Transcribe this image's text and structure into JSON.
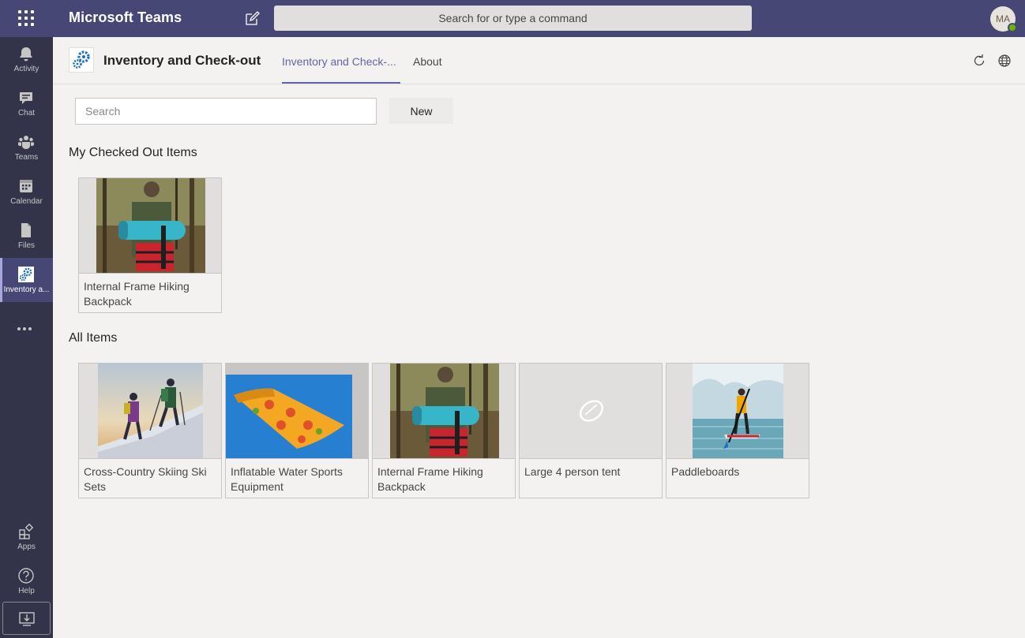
{
  "titlebar": {
    "app_name": "Microsoft Teams",
    "search_placeholder": "Search for or type a command",
    "avatar_initials": "MA"
  },
  "rail": {
    "items": [
      {
        "label": "Activity",
        "icon": "bell-icon"
      },
      {
        "label": "Chat",
        "icon": "chat-icon"
      },
      {
        "label": "Teams",
        "icon": "teams-icon"
      },
      {
        "label": "Calendar",
        "icon": "calendar-icon"
      },
      {
        "label": "Files",
        "icon": "file-icon"
      },
      {
        "label": "Inventory a...",
        "icon": "gear-icon",
        "active": true
      }
    ],
    "bottom_items": [
      {
        "label": "Apps",
        "icon": "apps-icon"
      },
      {
        "label": "Help",
        "icon": "help-icon"
      }
    ]
  },
  "app": {
    "title": "Inventory and Check-out",
    "tabs": [
      {
        "label": "Inventory and Check-...",
        "active": true
      },
      {
        "label": "About",
        "active": false
      }
    ]
  },
  "toolbar": {
    "search_placeholder": "Search",
    "new_label": "New"
  },
  "sections": {
    "checked_out": {
      "title": "My Checked Out Items",
      "items": [
        {
          "label": "Internal Frame Hiking Backpack",
          "image": "backpack-photo"
        }
      ]
    },
    "all_items": {
      "title": "All Items",
      "items": [
        {
          "label": "Cross-Country Skiing Ski Sets",
          "image": "hikers-photo"
        },
        {
          "label": "Inflatable Water Sports Equipment",
          "image": "pizza-float-photo"
        },
        {
          "label": "Internal Frame Hiking Backpack",
          "image": "backpack-photo"
        },
        {
          "label": "Large 4 person tent",
          "image": "placeholder-icon"
        },
        {
          "label": "Paddleboards",
          "image": "paddleboard-photo"
        }
      ]
    }
  },
  "colors": {
    "titlebar": "#464775",
    "rail": "#33344a",
    "accent": "#6264a7",
    "background": "#f3f2f1",
    "presence": "#6bb700"
  }
}
